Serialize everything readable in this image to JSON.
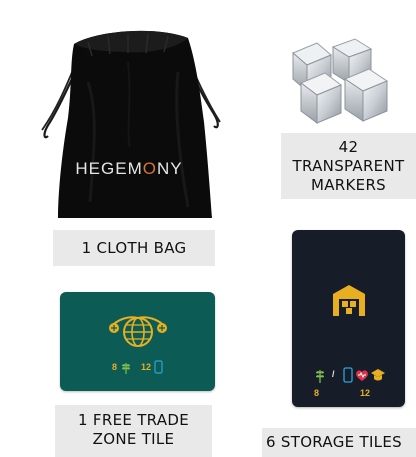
{
  "bag": {
    "brand_prefix": "HEGEM",
    "brand_accent": "O",
    "brand_suffix": "NY",
    "label": "1 CLOTH BAG",
    "color": "#0b0b0b"
  },
  "markers": {
    "label_line1": "42",
    "label_line2": "TRANSPARENT",
    "label_line3": "MARKERS",
    "icon": "transparent-cubes"
  },
  "free_trade_zone": {
    "value_left": "8",
    "value_right": "12",
    "label_line1": "1 FREE TRADE",
    "label_line2": "ZONE TILE",
    "tile_color": "#0d5b55",
    "accent_color": "#e8b020",
    "icons": [
      "globe-trade-icon",
      "wheat-icon",
      "phone-icon"
    ]
  },
  "storage": {
    "value_left": "8",
    "value_right": "12",
    "separator": "/",
    "label": "6 STORAGE TILES",
    "tile_color": "#161d29",
    "icons": [
      "warehouse-icon",
      "wheat-icon",
      "phone-icon",
      "health-icon",
      "education-icon"
    ]
  }
}
